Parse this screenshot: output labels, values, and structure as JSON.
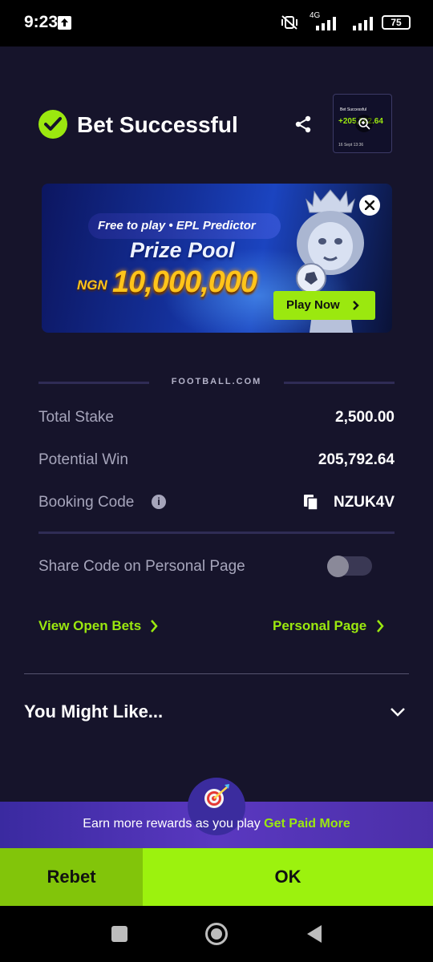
{
  "status_bar": {
    "time": "9:23",
    "network": "4G",
    "battery": "75"
  },
  "header": {
    "title": "Bet Successful",
    "thumbnail": {
      "heading": "Bet Successful",
      "amount": "+205,792.64",
      "date": "16 Sept 13:36"
    }
  },
  "banner": {
    "free_to_play": "Free to play  • EPL Predictor",
    "prize_pool": "Prize Pool",
    "currency": "NGN",
    "amount": "10,000,000",
    "play_now": "Play Now"
  },
  "brand": "FOOTBALL.COM",
  "summary": {
    "total_stake_label": "Total Stake",
    "total_stake_value": "2,500.00",
    "potential_win_label": "Potential Win",
    "potential_win_value": "205,792.64",
    "booking_code_label": "Booking Code",
    "booking_code_value": "NZUK4V"
  },
  "share_code": {
    "label": "Share Code on Personal Page",
    "enabled": false
  },
  "links": {
    "view_open_bets": "View Open Bets",
    "personal_page": "Personal Page"
  },
  "you_might_like": "You Might Like...",
  "rewards": {
    "text": "Earn more rewards as you play",
    "link": "Get Paid More"
  },
  "buttons": {
    "rebet": "Rebet",
    "ok": "OK"
  },
  "colors": {
    "background": "#16142b",
    "accent_green": "#9be80f",
    "rebet_green": "#82c50a",
    "rewards_purple": "#4b2fa8"
  }
}
